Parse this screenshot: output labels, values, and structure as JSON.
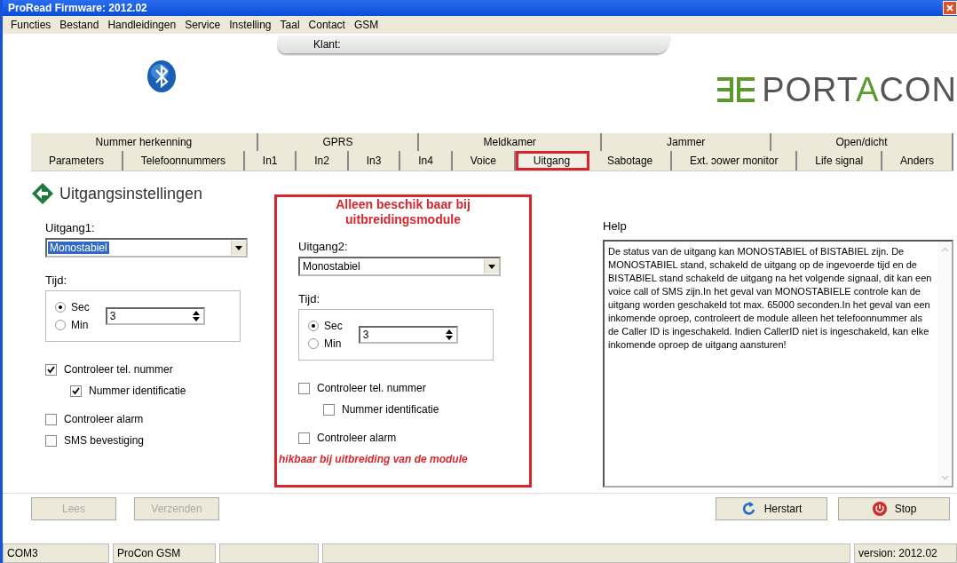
{
  "window": {
    "title": "ProRead Firmware: 2012.02"
  },
  "menu": [
    "Functies",
    "Bestand",
    "Handleidingen",
    "Service",
    "Instelling",
    "Taal",
    "Contact",
    "GSM"
  ],
  "header": {
    "customer_label": "Klant:",
    "logo": [
      {
        "text": "PORT",
        "accent": false
      },
      {
        "text": "A",
        "accent": true
      },
      {
        "text": "CON",
        "accent": false
      }
    ]
  },
  "tabs_row_1": [
    {
      "label": "Nummer herkenning",
      "selected": false
    },
    {
      "label": "GPRS",
      "selected": false
    },
    {
      "label": "Meldkamer",
      "selected": false
    },
    {
      "label": "Jammer",
      "selected": false
    },
    {
      "label": "Open/dicht",
      "selected": false
    }
  ],
  "tabs_row_2": [
    {
      "label": "Parameters",
      "selected": false,
      "annotated": false
    },
    {
      "label": "Telefoonnummers",
      "selected": false,
      "annotated": false
    },
    {
      "label": "In1",
      "selected": false,
      "annotated": false
    },
    {
      "label": "In2",
      "selected": false,
      "annotated": false
    },
    {
      "label": "In3",
      "selected": false,
      "annotated": false
    },
    {
      "label": "In4",
      "selected": false,
      "annotated": false
    },
    {
      "label": "Voice",
      "selected": false,
      "annotated": false
    },
    {
      "label": "Uitgang",
      "selected": true,
      "annotated": true
    },
    {
      "label": "Sabotage",
      "selected": false,
      "annotated": false
    },
    {
      "label": "Ext. ɔower monitor",
      "selected": false,
      "annotated": false
    },
    {
      "label": "Life signal",
      "selected": false,
      "annotated": false
    },
    {
      "label": "Anders",
      "selected": false,
      "annotated": false
    }
  ],
  "page_title": "Uitgangsinstellingen",
  "outputs": [
    {
      "label": "Uitgang1:",
      "mode": "Monostabiel",
      "mode_selected": true,
      "annotated": false,
      "time_label": "Tijd:",
      "units": [
        {
          "label": "Sec",
          "selected": true
        },
        {
          "label": "Min",
          "selected": false
        }
      ],
      "time_value": "3",
      "checks": [
        {
          "label": "Controleer tel. nummer",
          "checked": true,
          "indented": false
        },
        {
          "label": "Nummer identificatie",
          "checked": true,
          "indented": true
        },
        {
          "label": "Controleer alarm",
          "checked": false,
          "indented": false
        },
        {
          "label": "SMS bevestiging",
          "checked": false,
          "indented": false
        }
      ]
    },
    {
      "label": "Uitgang2:",
      "mode": "Monostabiel",
      "mode_selected": false,
      "annotated": true,
      "note_top": "Alleen beschik baar bij uitbreidingsmodule",
      "note_bottom": "hikbaar bij uitbreiding van de module",
      "time_label": "Tijd:",
      "units": [
        {
          "label": "Sec",
          "selected": true
        },
        {
          "label": "Min",
          "selected": false
        }
      ],
      "time_value": "3",
      "checks": [
        {
          "label": "Controleer tel. nummer",
          "checked": false,
          "indented": false
        },
        {
          "label": "Nummer identificatie",
          "checked": false,
          "indented": true
        },
        {
          "label": "Controleer alarm",
          "checked": false,
          "indented": false
        }
      ]
    }
  ],
  "help": {
    "label": "Help",
    "text": "De status van de uitgang kan MONOSTABIEL of BISTABIEL zijn. De MONOSTABIEL stand, schakeld de uitgang op de ingevoerde tijd en de BISTABIEL stand schakeld de uitgang na het volgende signaal, dit kan een voice call of SMS zijn.In het geval van MONOSTABIELE controle kan de uitgang worden geschakeld tot max. 65000 seconden.In het geval van een inkomende oproep, controleert de module alleen het telefoonnummer als de Caller ID is ingeschakeld. Indien CallerID niet is ingeschakeld, kan elke inkomende oproep de uitgang aansturen!"
  },
  "buttons_left": [
    {
      "label": "Lees",
      "disabled": true
    },
    {
      "label": "Verzenden",
      "disabled": true
    }
  ],
  "buttons_right": [
    {
      "label": "Herstart",
      "kind": "restart"
    },
    {
      "label": "Stop",
      "kind": "stop"
    }
  ],
  "status_bar": {
    "port": "COM3",
    "device": "ProCon GSM",
    "version": "version: 2012.02"
  }
}
